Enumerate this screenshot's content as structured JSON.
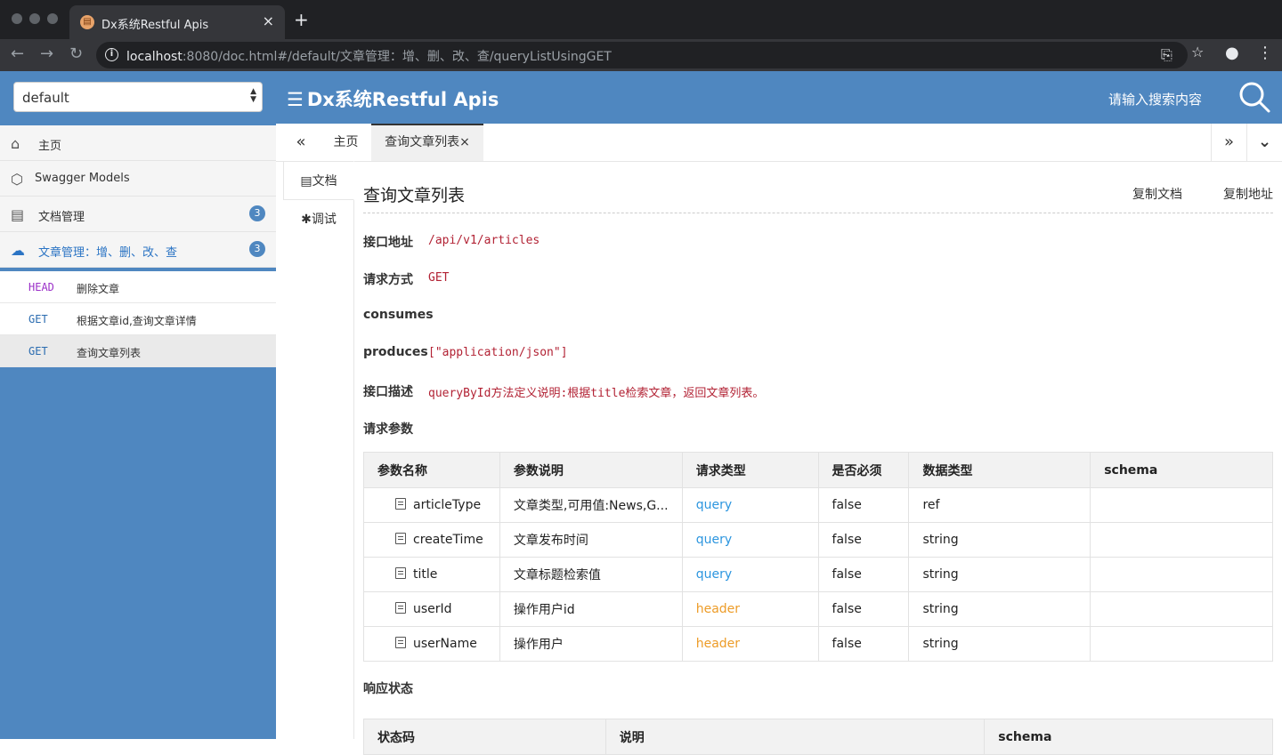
{
  "browser": {
    "tab_title": "Dx系统Restful Apis",
    "tab_close": "×",
    "new_tab": "+",
    "url_host": "localhost",
    "url_rest": ":8080/doc.html#/default/文章管理：增、删、改、查/queryListUsingGET"
  },
  "header": {
    "group_value": "default",
    "title": "Dx系统Restful Apis",
    "search_placeholder": "请输入搜索内容"
  },
  "sidebar": {
    "items": [
      {
        "label": "主页",
        "icon": "home-icon"
      },
      {
        "label": "Swagger Models",
        "icon": "cube-icon"
      },
      {
        "label": "文档管理",
        "icon": "doc-settings-icon",
        "badge": "3"
      },
      {
        "label": "文章管理：增、删、改、查",
        "icon": "cloud-api-icon",
        "badge": "3"
      }
    ],
    "apis": [
      {
        "method": "HEAD",
        "name": "删除文章"
      },
      {
        "method": "GET",
        "name": "根据文章id,查询文章详情"
      },
      {
        "method": "GET",
        "name": "查询文章列表"
      }
    ]
  },
  "tabs": {
    "prev": "«",
    "home": "主页",
    "current": "查询文章列表×",
    "next": "»",
    "more": "⌄"
  },
  "vtabs": {
    "doc": "文档",
    "debug": "调试"
  },
  "doc": {
    "title": "查询文章列表",
    "copy_doc": "复制文档",
    "copy_addr": "复制地址",
    "url_label": "接口地址",
    "url_value": "/api/v1/articles",
    "method_label": "请求方式",
    "method_value": "GET",
    "consumes_label": "consumes",
    "produces_label": "produces",
    "produces_value": "[\"application/json\"]",
    "desc_label": "接口描述",
    "desc_value": "queryById方法定义说明:根据title检索文章，返回文章列表。",
    "params_label": "请求参数",
    "params_headers": [
      "参数名称",
      "参数说明",
      "请求类型",
      "是否必须",
      "数据类型",
      "schema"
    ],
    "params": [
      {
        "name": "articleType",
        "desc": "文章类型,可用值:News,G...",
        "in": "query",
        "required": "false",
        "type": "ref",
        "schema": ""
      },
      {
        "name": "createTime",
        "desc": "文章发布时间",
        "in": "query",
        "required": "false",
        "type": "string",
        "schema": ""
      },
      {
        "name": "title",
        "desc": "文章标题检索值",
        "in": "query",
        "required": "false",
        "type": "string",
        "schema": ""
      },
      {
        "name": "userId",
        "desc": "操作用户id",
        "in": "header",
        "required": "false",
        "type": "string",
        "schema": ""
      },
      {
        "name": "userName",
        "desc": "操作用户",
        "in": "header",
        "required": "false",
        "type": "string",
        "schema": ""
      }
    ],
    "resp_label": "响应状态",
    "resp_headers": [
      "状态码",
      "说明",
      "schema"
    ]
  },
  "colors": {
    "brand": "#4f87c0",
    "query": "#2d96df",
    "header": "#ed9c28",
    "code": "#b22234"
  }
}
